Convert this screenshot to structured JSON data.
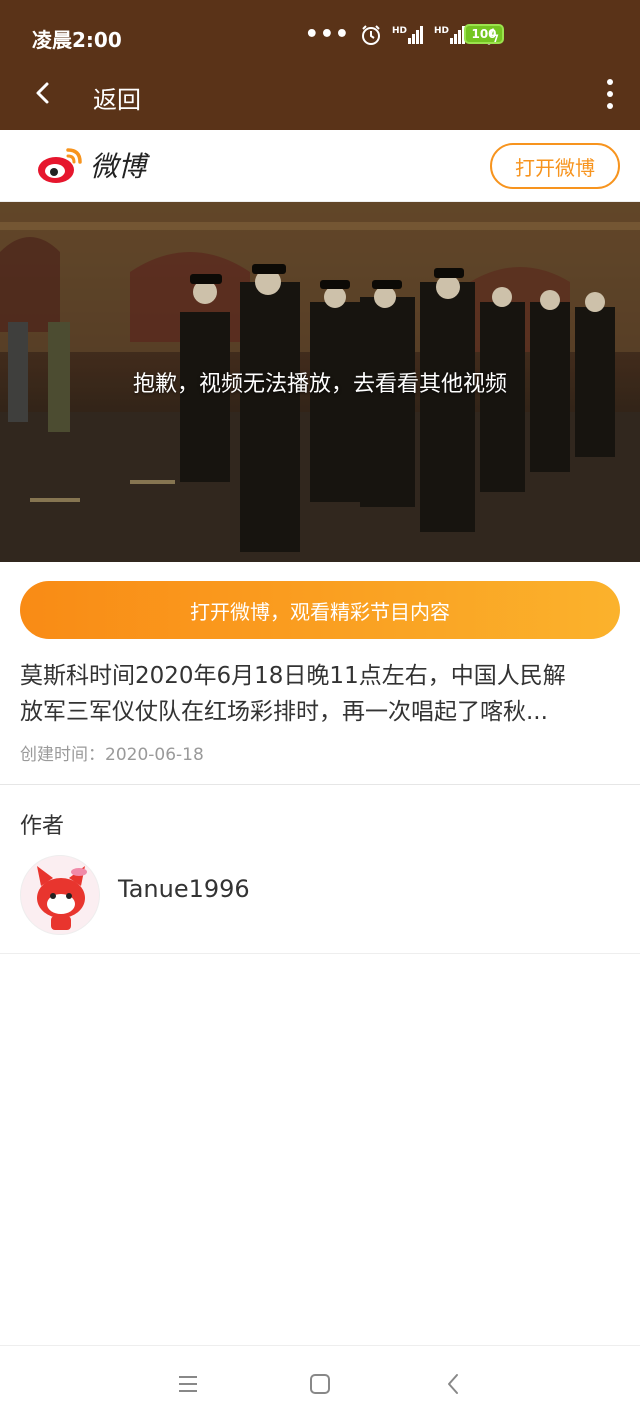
{
  "status": {
    "time": "凌晨2:00",
    "more_dots": "•••",
    "signal1": "HD",
    "signal2": "HD",
    "battery": "100",
    "icons": [
      "alarm-icon",
      "signal-icon",
      "signal-icon",
      "wifi-icon",
      "battery-icon",
      "charging-icon"
    ]
  },
  "appbar": {
    "back_label": "返回"
  },
  "weibo": {
    "logo_text": "微博",
    "open_button": "打开微博"
  },
  "video": {
    "message": "抱歉，视频无法播放，去看看其他视频"
  },
  "cta": {
    "label": "打开微博，观看精彩节目内容"
  },
  "post": {
    "line1": "莫斯科时间2020年6月18日晚11点左右，中国人民解",
    "line2": "放军三军仪仗队在红场彩排时，再一次唱起了喀秋...",
    "created_label": "创建时间：",
    "created_date": "2020-06-18"
  },
  "author": {
    "section_label": "作者",
    "name": "Tanue1996"
  },
  "colors": {
    "bar": "#5a3318",
    "accent": "#f7941e",
    "cta_start": "#f98b15",
    "cta_end": "#fbb22c"
  }
}
